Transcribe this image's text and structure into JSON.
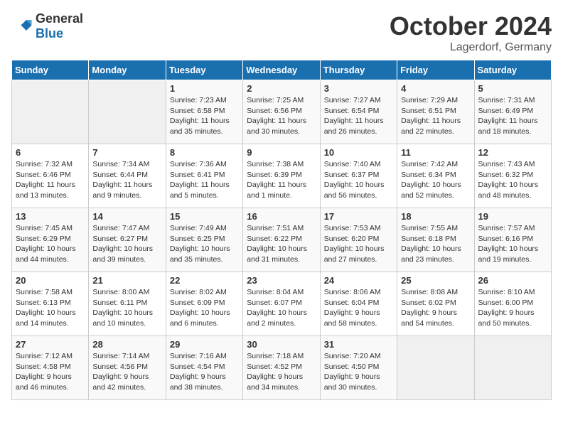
{
  "header": {
    "logo_general": "General",
    "logo_blue": "Blue",
    "month": "October 2024",
    "location": "Lagerdorf, Germany"
  },
  "weekdays": [
    "Sunday",
    "Monday",
    "Tuesday",
    "Wednesday",
    "Thursday",
    "Friday",
    "Saturday"
  ],
  "weeks": [
    [
      {
        "day": "",
        "empty": true
      },
      {
        "day": "",
        "empty": true
      },
      {
        "day": "1",
        "sunrise": "Sunrise: 7:23 AM",
        "sunset": "Sunset: 6:58 PM",
        "daylight": "Daylight: 11 hours and 35 minutes."
      },
      {
        "day": "2",
        "sunrise": "Sunrise: 7:25 AM",
        "sunset": "Sunset: 6:56 PM",
        "daylight": "Daylight: 11 hours and 30 minutes."
      },
      {
        "day": "3",
        "sunrise": "Sunrise: 7:27 AM",
        "sunset": "Sunset: 6:54 PM",
        "daylight": "Daylight: 11 hours and 26 minutes."
      },
      {
        "day": "4",
        "sunrise": "Sunrise: 7:29 AM",
        "sunset": "Sunset: 6:51 PM",
        "daylight": "Daylight: 11 hours and 22 minutes."
      },
      {
        "day": "5",
        "sunrise": "Sunrise: 7:31 AM",
        "sunset": "Sunset: 6:49 PM",
        "daylight": "Daylight: 11 hours and 18 minutes."
      }
    ],
    [
      {
        "day": "6",
        "sunrise": "Sunrise: 7:32 AM",
        "sunset": "Sunset: 6:46 PM",
        "daylight": "Daylight: 11 hours and 13 minutes."
      },
      {
        "day": "7",
        "sunrise": "Sunrise: 7:34 AM",
        "sunset": "Sunset: 6:44 PM",
        "daylight": "Daylight: 11 hours and 9 minutes."
      },
      {
        "day": "8",
        "sunrise": "Sunrise: 7:36 AM",
        "sunset": "Sunset: 6:41 PM",
        "daylight": "Daylight: 11 hours and 5 minutes."
      },
      {
        "day": "9",
        "sunrise": "Sunrise: 7:38 AM",
        "sunset": "Sunset: 6:39 PM",
        "daylight": "Daylight: 11 hours and 1 minute."
      },
      {
        "day": "10",
        "sunrise": "Sunrise: 7:40 AM",
        "sunset": "Sunset: 6:37 PM",
        "daylight": "Daylight: 10 hours and 56 minutes."
      },
      {
        "day": "11",
        "sunrise": "Sunrise: 7:42 AM",
        "sunset": "Sunset: 6:34 PM",
        "daylight": "Daylight: 10 hours and 52 minutes."
      },
      {
        "day": "12",
        "sunrise": "Sunrise: 7:43 AM",
        "sunset": "Sunset: 6:32 PM",
        "daylight": "Daylight: 10 hours and 48 minutes."
      }
    ],
    [
      {
        "day": "13",
        "sunrise": "Sunrise: 7:45 AM",
        "sunset": "Sunset: 6:29 PM",
        "daylight": "Daylight: 10 hours and 44 minutes."
      },
      {
        "day": "14",
        "sunrise": "Sunrise: 7:47 AM",
        "sunset": "Sunset: 6:27 PM",
        "daylight": "Daylight: 10 hours and 39 minutes."
      },
      {
        "day": "15",
        "sunrise": "Sunrise: 7:49 AM",
        "sunset": "Sunset: 6:25 PM",
        "daylight": "Daylight: 10 hours and 35 minutes."
      },
      {
        "day": "16",
        "sunrise": "Sunrise: 7:51 AM",
        "sunset": "Sunset: 6:22 PM",
        "daylight": "Daylight: 10 hours and 31 minutes."
      },
      {
        "day": "17",
        "sunrise": "Sunrise: 7:53 AM",
        "sunset": "Sunset: 6:20 PM",
        "daylight": "Daylight: 10 hours and 27 minutes."
      },
      {
        "day": "18",
        "sunrise": "Sunrise: 7:55 AM",
        "sunset": "Sunset: 6:18 PM",
        "daylight": "Daylight: 10 hours and 23 minutes."
      },
      {
        "day": "19",
        "sunrise": "Sunrise: 7:57 AM",
        "sunset": "Sunset: 6:16 PM",
        "daylight": "Daylight: 10 hours and 19 minutes."
      }
    ],
    [
      {
        "day": "20",
        "sunrise": "Sunrise: 7:58 AM",
        "sunset": "Sunset: 6:13 PM",
        "daylight": "Daylight: 10 hours and 14 minutes."
      },
      {
        "day": "21",
        "sunrise": "Sunrise: 8:00 AM",
        "sunset": "Sunset: 6:11 PM",
        "daylight": "Daylight: 10 hours and 10 minutes."
      },
      {
        "day": "22",
        "sunrise": "Sunrise: 8:02 AM",
        "sunset": "Sunset: 6:09 PM",
        "daylight": "Daylight: 10 hours and 6 minutes."
      },
      {
        "day": "23",
        "sunrise": "Sunrise: 8:04 AM",
        "sunset": "Sunset: 6:07 PM",
        "daylight": "Daylight: 10 hours and 2 minutes."
      },
      {
        "day": "24",
        "sunrise": "Sunrise: 8:06 AM",
        "sunset": "Sunset: 6:04 PM",
        "daylight": "Daylight: 9 hours and 58 minutes."
      },
      {
        "day": "25",
        "sunrise": "Sunrise: 8:08 AM",
        "sunset": "Sunset: 6:02 PM",
        "daylight": "Daylight: 9 hours and 54 minutes."
      },
      {
        "day": "26",
        "sunrise": "Sunrise: 8:10 AM",
        "sunset": "Sunset: 6:00 PM",
        "daylight": "Daylight: 9 hours and 50 minutes."
      }
    ],
    [
      {
        "day": "27",
        "sunrise": "Sunrise: 7:12 AM",
        "sunset": "Sunset: 4:58 PM",
        "daylight": "Daylight: 9 hours and 46 minutes."
      },
      {
        "day": "28",
        "sunrise": "Sunrise: 7:14 AM",
        "sunset": "Sunset: 4:56 PM",
        "daylight": "Daylight: 9 hours and 42 minutes."
      },
      {
        "day": "29",
        "sunrise": "Sunrise: 7:16 AM",
        "sunset": "Sunset: 4:54 PM",
        "daylight": "Daylight: 9 hours and 38 minutes."
      },
      {
        "day": "30",
        "sunrise": "Sunrise: 7:18 AM",
        "sunset": "Sunset: 4:52 PM",
        "daylight": "Daylight: 9 hours and 34 minutes."
      },
      {
        "day": "31",
        "sunrise": "Sunrise: 7:20 AM",
        "sunset": "Sunset: 4:50 PM",
        "daylight": "Daylight: 9 hours and 30 minutes."
      },
      {
        "day": "",
        "empty": true
      },
      {
        "day": "",
        "empty": true
      }
    ]
  ]
}
